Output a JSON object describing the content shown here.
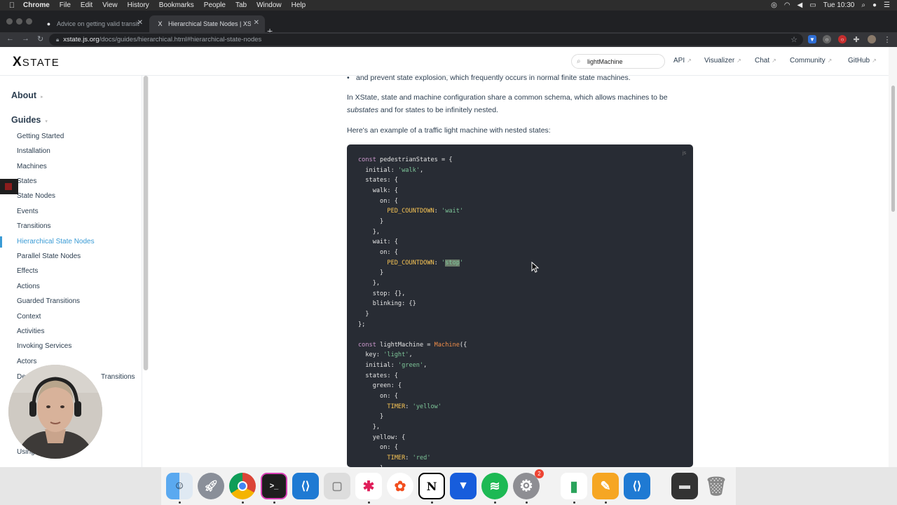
{
  "menubar": {
    "apple": "",
    "items": [
      "Chrome",
      "File",
      "Edit",
      "View",
      "History",
      "Bookmarks",
      "People",
      "Tab",
      "Window",
      "Help"
    ],
    "clock": "Tue 10:30"
  },
  "browser": {
    "tabs": [
      {
        "title": "Advice on getting valid transiti"
      },
      {
        "title": "Hierarchical State Nodes | XSt"
      }
    ],
    "url_host": "xstate.js.org",
    "url_path": "/docs/guides/hierarchical.html#hierarchical-state-nodes"
  },
  "site": {
    "logo_mark": "X",
    "logo_text": "STATE",
    "search_value": "lightMachine",
    "nav": [
      "API",
      "Visualizer",
      "Chat",
      "Community",
      "GitHub"
    ]
  },
  "sidebar": {
    "about": "About",
    "guides": "Guides",
    "items": [
      "Getting Started",
      "Installation",
      "Machines",
      "States",
      "State Nodes",
      "Events",
      "Transitions",
      "Hierarchical State Nodes",
      "Parallel State Nodes",
      "Effects",
      "Actions",
      "Guarded Transitions",
      "Context",
      "Activities",
      "Invoking Services",
      "Actors",
      "Delayed Events and Transitions",
      "Using"
    ],
    "partial_1": "De",
    "partial_1b": "Transitions"
  },
  "content": {
    "bullet": "and prevent state explosion, which frequently occurs in normal finite state machines.",
    "para1_a": "In XState, state and machine configuration share a common schema, which allows machines to be",
    "para1_em": "substates",
    "para1_b": " and for states to be infinitely nested.",
    "para2": "Here's an example of a traffic light machine with nested states:",
    "code_lang": "js"
  },
  "dock": {
    "apps": [
      "finder-icon",
      "launchpad-icon",
      "chrome-icon",
      "terminal-icon",
      "vscode-icon",
      "preview-icon",
      "slack-icon",
      "figma-icon",
      "notion-icon",
      "bitwarden-icon",
      "spotify-icon",
      "system-preferences-icon",
      "numbers-icon",
      "pages-icon",
      "vscode-insiders-icon",
      "screenshot-icon",
      "trash-icon"
    ],
    "badge_count": "2"
  }
}
